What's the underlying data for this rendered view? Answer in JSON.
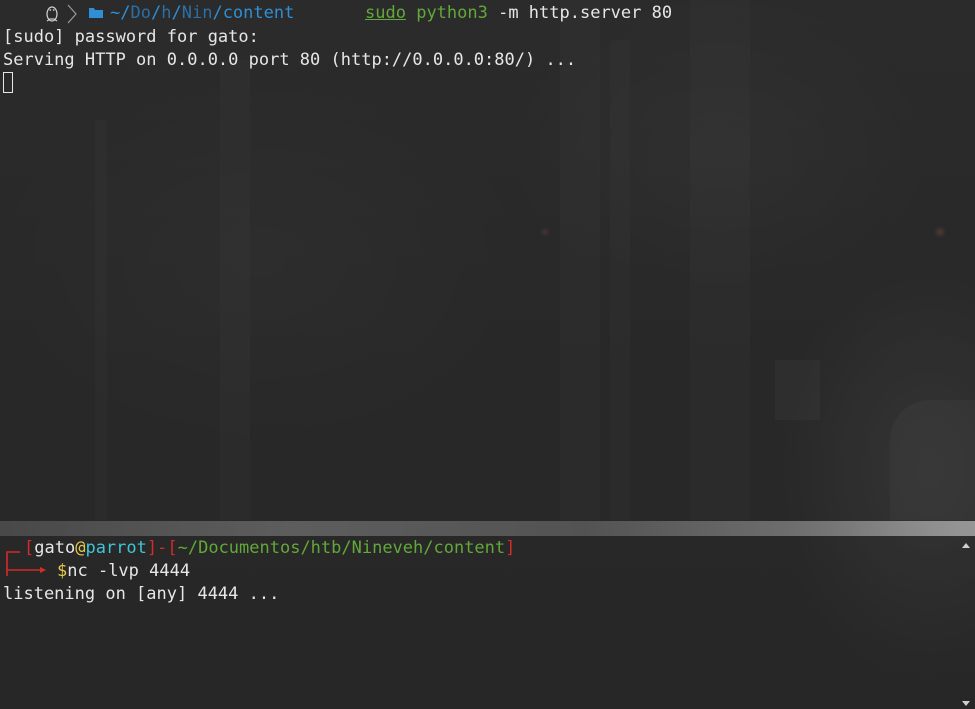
{
  "top_terminal": {
    "prompt": {
      "path_parts": [
        "~/",
        "Do",
        "/",
        "h",
        "/",
        "Nin",
        "/",
        "content"
      ],
      "icon_os": "linux-tux-icon",
      "icon_folder": "folder-icon"
    },
    "command": {
      "sudo": "sudo",
      "program": "python3",
      "args": " -m http.server 80"
    },
    "output": [
      "[sudo] password for gato:",
      "Serving HTTP on 0.0.0.0 port 80 (http://0.0.0.0:80/) ..."
    ]
  },
  "bottom_terminal": {
    "prompt": {
      "open_bracket": "[",
      "user": "gato",
      "at": "@",
      "host": "parrot",
      "close_bracket": "]",
      "dash": "-",
      "path_open": "[",
      "path": "~/Documentos/htb/Nineveh/content",
      "path_close": "]",
      "dollar": "$"
    },
    "command": "nc -lvp 4444",
    "output": [
      "listening on [any] 4444 ..."
    ]
  },
  "colors": {
    "prompt_red": "#d42a2a",
    "path_blue": "#2e8fd6",
    "cmd_green": "#62a83a",
    "host_cyan": "#3fc6d6",
    "dollar_yellow": "#e6c94a"
  }
}
